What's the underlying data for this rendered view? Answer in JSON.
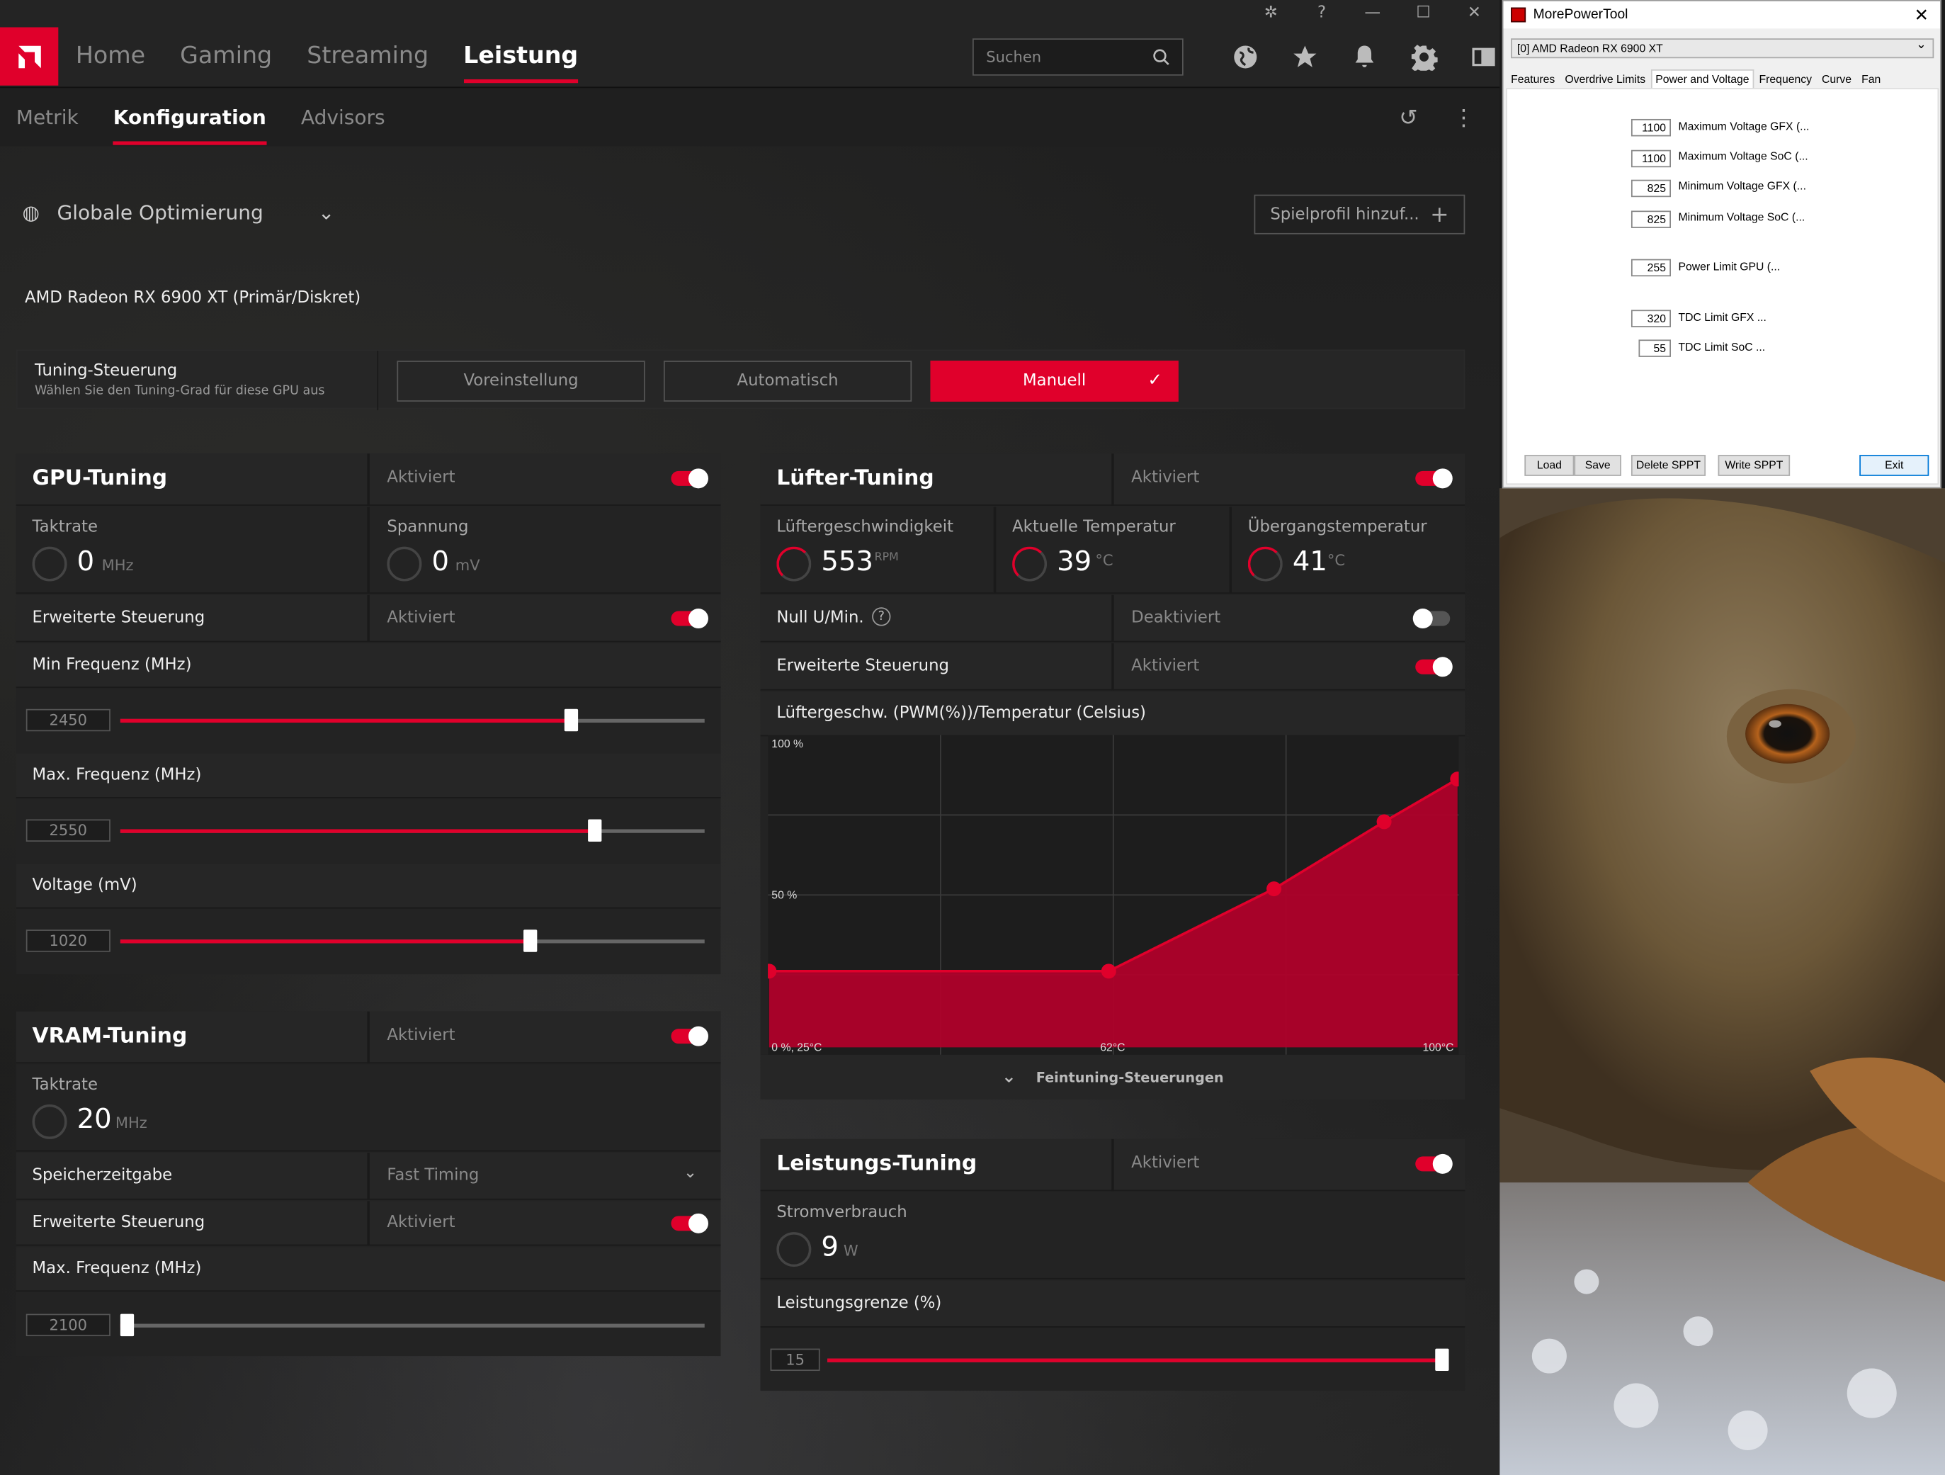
{
  "amd": {
    "nav": [
      "Home",
      "Gaming",
      "Streaming",
      "Leistung"
    ],
    "active_nav": "Leistung",
    "search_placeholder": "Suchen",
    "subnav": [
      "Metrik",
      "Konfiguration",
      "Advisors"
    ],
    "profile": "Globale Optimierung",
    "add_profile": "Spielprofil hinzuf...",
    "gpu_name": "AMD Radeon RX 6900 XT (Primär/Diskret)",
    "tuning": {
      "label": "Tuning-Steuerung",
      "sub": "Wählen Sie den Tuning-Grad für diese GPU aus",
      "buttons": [
        "Voreinstellung",
        "Automatisch",
        "Manuell"
      ]
    },
    "gpu_tuning": {
      "title": "GPU-Tuning",
      "status": "Aktiviert",
      "clock_label": "Taktrate",
      "clock_value": "0",
      "clock_unit": "MHz",
      "volt_label": "Spannung",
      "volt_value": "0",
      "volt_unit": "mV",
      "adv_label": "Erweiterte Steuerung",
      "adv_status": "Aktiviert",
      "min_label": "Min Frequenz (MHz)",
      "min_value": "2450",
      "min_fraction": 0.77,
      "max_label": "Max. Frequenz (MHz)",
      "max_value": "2550",
      "max_fraction": 0.81,
      "vol_label": "Voltage (mV)",
      "vol_value": "1020",
      "vol_fraction": 0.7
    },
    "vram_tuning": {
      "title": "VRAM-Tuning",
      "status": "Aktiviert",
      "clock_label": "Taktrate",
      "clock_value": "20",
      "clock_unit": "MHz",
      "timing_label": "Speicherzeitgabe",
      "timing_value": "Fast Timing",
      "adv_label": "Erweiterte Steuerung",
      "adv_status": "Aktiviert",
      "max_label": "Max. Frequenz (MHz)",
      "max_value": "2100",
      "max_fraction": 0.01
    },
    "fan_tuning": {
      "title": "Lüfter-Tuning",
      "status": "Aktiviert",
      "speed_label": "Lüftergeschwindigkeit",
      "speed_value": "553",
      "speed_unit": "RPM",
      "temp_label": "Aktuelle Temperatur",
      "temp_value": "39",
      "temp_unit": "°C",
      "junc_label": "Übergangstemperatur",
      "junc_value": "41",
      "junc_unit": "°C",
      "zero_label": "Null U/Min.",
      "zero_status": "Deaktiviert",
      "adv_label": "Erweiterte Steuerung",
      "adv_status": "Aktiviert",
      "chart_title": "Lüftergeschw. (PWM(%))/Temperatur (Celsius)",
      "finetune": "Feintuning-Steuerungen"
    },
    "power_tuning": {
      "title": "Leistungs-Tuning",
      "status": "Aktiviert",
      "power_label": "Stromverbrauch",
      "power_value": "9",
      "power_unit": "W",
      "limit_label": "Leistungsgrenze (%)",
      "limit_value": "15",
      "limit_fraction": 1.0
    }
  },
  "chart_data": {
    "type": "area",
    "title": "Lüftergeschw. (PWM(%))/Temperatur (Celsius)",
    "x_ticks": [
      "0 %, 25°C",
      "62°C",
      "100°C"
    ],
    "y_ticks": [
      "100 %",
      "50 %"
    ],
    "xlim": [
      25,
      100
    ],
    "ylim": [
      0,
      100
    ],
    "x": [
      25,
      62,
      80,
      92,
      100
    ],
    "y": [
      25,
      25,
      52,
      74,
      88
    ],
    "color": "#e0002b"
  },
  "mpt": {
    "title": "MorePowerTool",
    "device": "[0] AMD Radeon RX 6900 XT",
    "tabs": [
      "Features",
      "Overdrive Limits",
      "Power and Voltage",
      "Frequency",
      "Curve",
      "Fan"
    ],
    "active_tab": "Power and Voltage",
    "fields": [
      {
        "value": "1100",
        "label": "Maximum Voltage GFX (..."
      },
      {
        "value": "1100",
        "label": "Maximum Voltage SoC (..."
      },
      {
        "value": "825",
        "label": "Minimum Voltage GFX (..."
      },
      {
        "value": "825",
        "label": "Minimum Voltage SoC (..."
      },
      {
        "value": "255",
        "label": "Power Limit GPU (..."
      },
      {
        "value": "320",
        "label": "TDC Limit GFX ..."
      },
      {
        "value": "55",
        "label": "TDC Limit SoC ..."
      }
    ],
    "buttons": [
      "Load",
      "Save",
      "Delete SPPT",
      "Write SPPT",
      "Exit"
    ]
  }
}
